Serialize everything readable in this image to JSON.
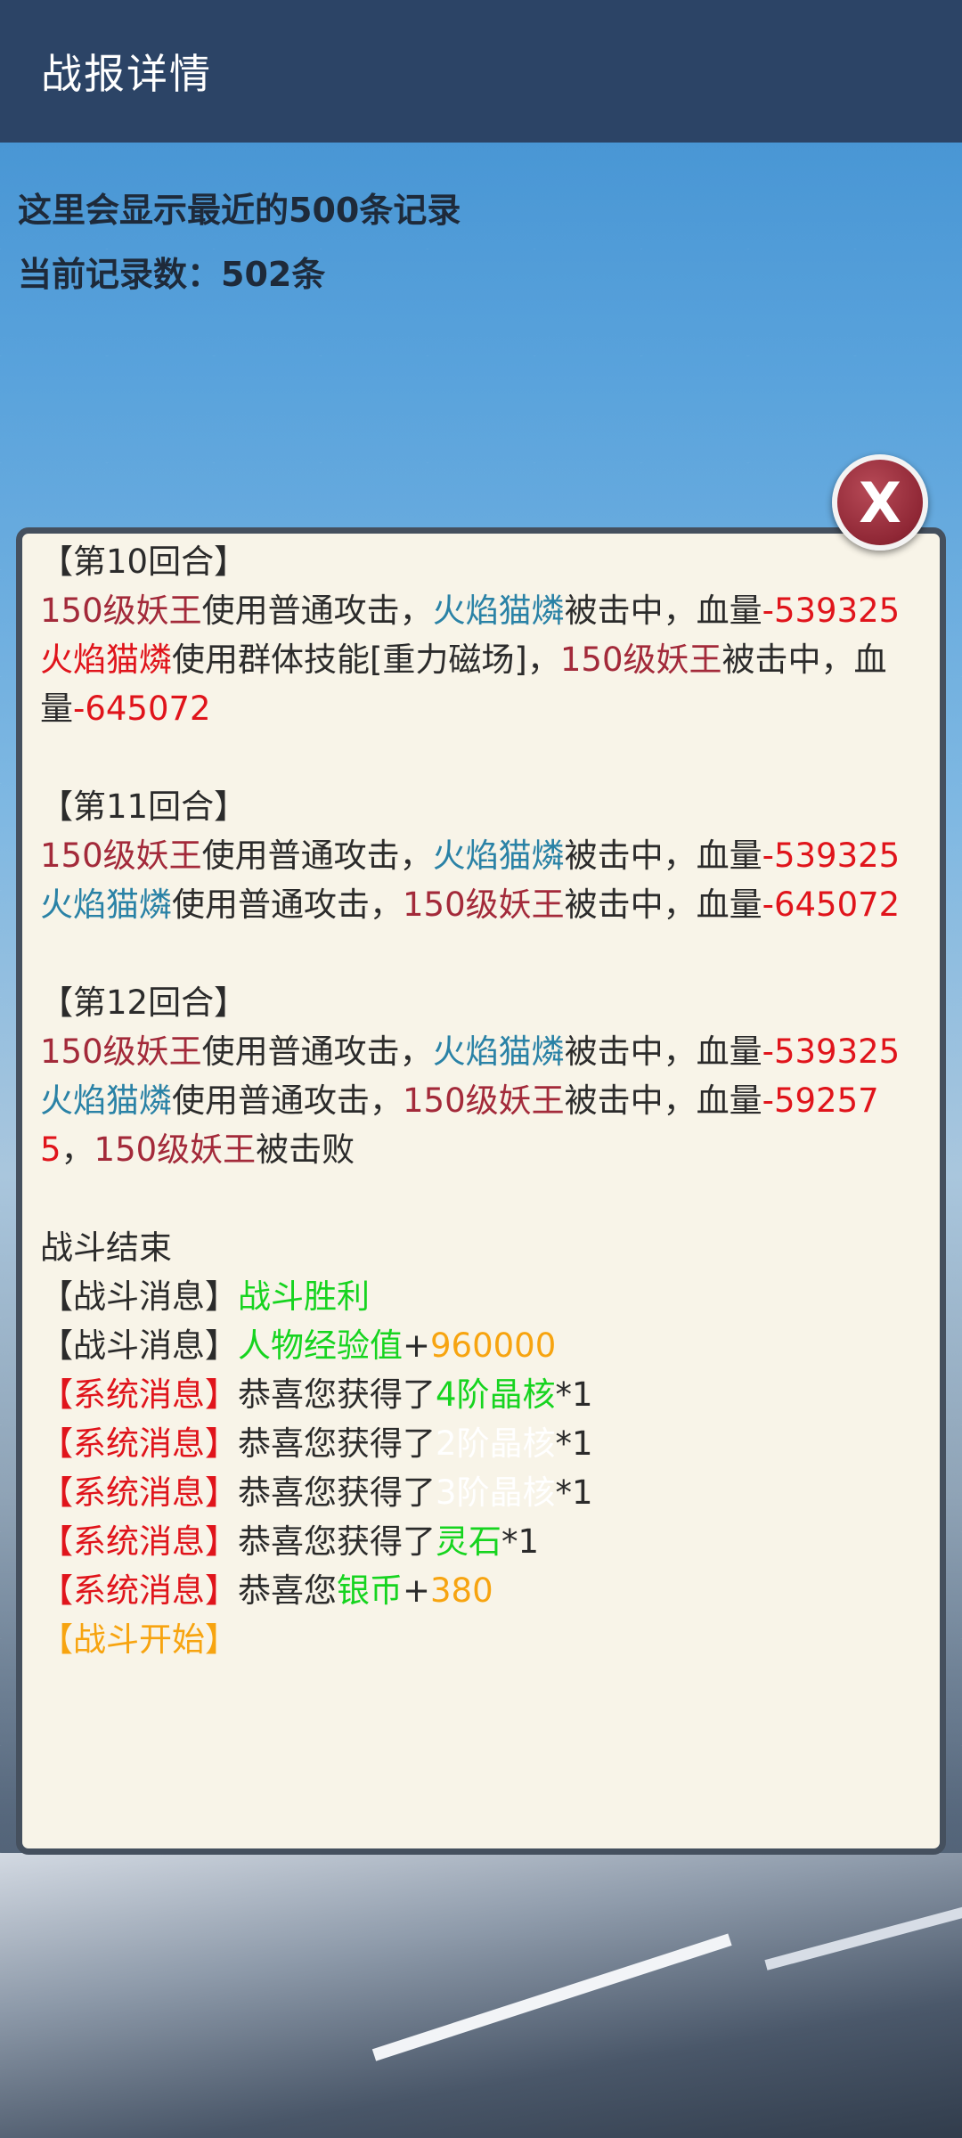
{
  "header": {
    "title": "战报详情"
  },
  "info": {
    "line1": "这里会显示最近的500条记录",
    "line2": "当前记录数：502条"
  },
  "close_button": {
    "label": "X"
  },
  "colors": {
    "header_bg": "#2c4466",
    "panel_bg": "#f8f4e8",
    "damage_red": "#e0141b",
    "enemy_maroon": "#a32a3a",
    "player_blue": "#2a82a6",
    "reward_green": "#16d41f",
    "value_orange": "#f7a410"
  },
  "log": [
    {
      "type": "line",
      "segments": [
        {
          "text": "【第10回合】",
          "color": "default"
        }
      ]
    },
    {
      "type": "line",
      "segments": [
        {
          "text": "150级妖王",
          "color": "maroon"
        },
        {
          "text": "使用普通攻击，",
          "color": "default"
        },
        {
          "text": "火焰猫燐",
          "color": "blue"
        },
        {
          "text": "被击中，血量",
          "color": "default"
        },
        {
          "text": "-539325",
          "color": "red"
        }
      ]
    },
    {
      "type": "line",
      "segments": [
        {
          "text": "火焰猫燐",
          "color": "red"
        },
        {
          "text": "使用群体技能[重力磁场]，",
          "color": "default"
        },
        {
          "text": "150级妖王",
          "color": "maroon"
        },
        {
          "text": "被击中，血量",
          "color": "default"
        },
        {
          "text": "-645072",
          "color": "red"
        }
      ]
    },
    {
      "type": "blank"
    },
    {
      "type": "line",
      "segments": [
        {
          "text": "【第11回合】",
          "color": "default"
        }
      ]
    },
    {
      "type": "line",
      "segments": [
        {
          "text": "150级妖王",
          "color": "maroon"
        },
        {
          "text": "使用普通攻击，",
          "color": "default"
        },
        {
          "text": "火焰猫燐",
          "color": "blue"
        },
        {
          "text": "被击中，血量",
          "color": "default"
        },
        {
          "text": "-539325",
          "color": "red"
        }
      ]
    },
    {
      "type": "line",
      "segments": [
        {
          "text": "火焰猫燐",
          "color": "blue"
        },
        {
          "text": "使用普通攻击，",
          "color": "default"
        },
        {
          "text": "150级妖王",
          "color": "maroon"
        },
        {
          "text": "被击中，血量",
          "color": "default"
        },
        {
          "text": "-645072",
          "color": "red"
        }
      ]
    },
    {
      "type": "blank"
    },
    {
      "type": "line",
      "segments": [
        {
          "text": "【第12回合】",
          "color": "default"
        }
      ]
    },
    {
      "type": "line",
      "segments": [
        {
          "text": "150级妖王",
          "color": "maroon"
        },
        {
          "text": "使用普通攻击，",
          "color": "default"
        },
        {
          "text": "火焰猫燐",
          "color": "blue"
        },
        {
          "text": "被击中，血量",
          "color": "default"
        },
        {
          "text": "-539325",
          "color": "red"
        }
      ]
    },
    {
      "type": "line",
      "segments": [
        {
          "text": "火焰猫燐",
          "color": "blue"
        },
        {
          "text": "使用普通攻击，",
          "color": "default"
        },
        {
          "text": "150级妖王",
          "color": "maroon"
        },
        {
          "text": "被击中，血量",
          "color": "default"
        },
        {
          "text": "-592575",
          "color": "red"
        },
        {
          "text": "，",
          "color": "default"
        },
        {
          "text": "150级妖王",
          "color": "maroon"
        },
        {
          "text": "被击败",
          "color": "default"
        }
      ]
    },
    {
      "type": "blank"
    },
    {
      "type": "line",
      "segments": [
        {
          "text": "战斗结束",
          "color": "default"
        }
      ]
    },
    {
      "type": "line",
      "segments": [
        {
          "text": "【战斗消息】",
          "color": "default"
        },
        {
          "text": "战斗胜利",
          "color": "green"
        }
      ]
    },
    {
      "type": "line",
      "segments": [
        {
          "text": "【战斗消息】",
          "color": "default"
        },
        {
          "text": "人物经验值",
          "color": "green"
        },
        {
          "text": "+",
          "color": "default"
        },
        {
          "text": "960000",
          "color": "orange"
        }
      ]
    },
    {
      "type": "line",
      "segments": [
        {
          "text": "【系统消息】",
          "color": "red"
        },
        {
          "text": "恭喜您获得了",
          "color": "default"
        },
        {
          "text": "4阶晶核",
          "color": "green"
        },
        {
          "text": "*1",
          "color": "default"
        }
      ]
    },
    {
      "type": "line",
      "segments": [
        {
          "text": "【系统消息】",
          "color": "red"
        },
        {
          "text": "恭喜您获得了",
          "color": "default"
        },
        {
          "text": "2阶晶核",
          "color": "white"
        },
        {
          "text": "*1",
          "color": "default"
        }
      ]
    },
    {
      "type": "line",
      "segments": [
        {
          "text": "【系统消息】",
          "color": "red"
        },
        {
          "text": "恭喜您获得了",
          "color": "default"
        },
        {
          "text": "3阶晶核",
          "color": "white"
        },
        {
          "text": "*1",
          "color": "default"
        }
      ]
    },
    {
      "type": "line",
      "segments": [
        {
          "text": "【系统消息】",
          "color": "red"
        },
        {
          "text": "恭喜您获得了",
          "color": "default"
        },
        {
          "text": "灵石",
          "color": "green"
        },
        {
          "text": "*1",
          "color": "default"
        }
      ]
    },
    {
      "type": "line",
      "segments": [
        {
          "text": "【系统消息】",
          "color": "red"
        },
        {
          "text": "恭喜您",
          "color": "default"
        },
        {
          "text": "银币",
          "color": "green"
        },
        {
          "text": "+",
          "color": "default"
        },
        {
          "text": "380",
          "color": "orange"
        }
      ]
    },
    {
      "type": "line",
      "segments": [
        {
          "text": "【战斗开始】",
          "color": "orange"
        }
      ]
    }
  ]
}
